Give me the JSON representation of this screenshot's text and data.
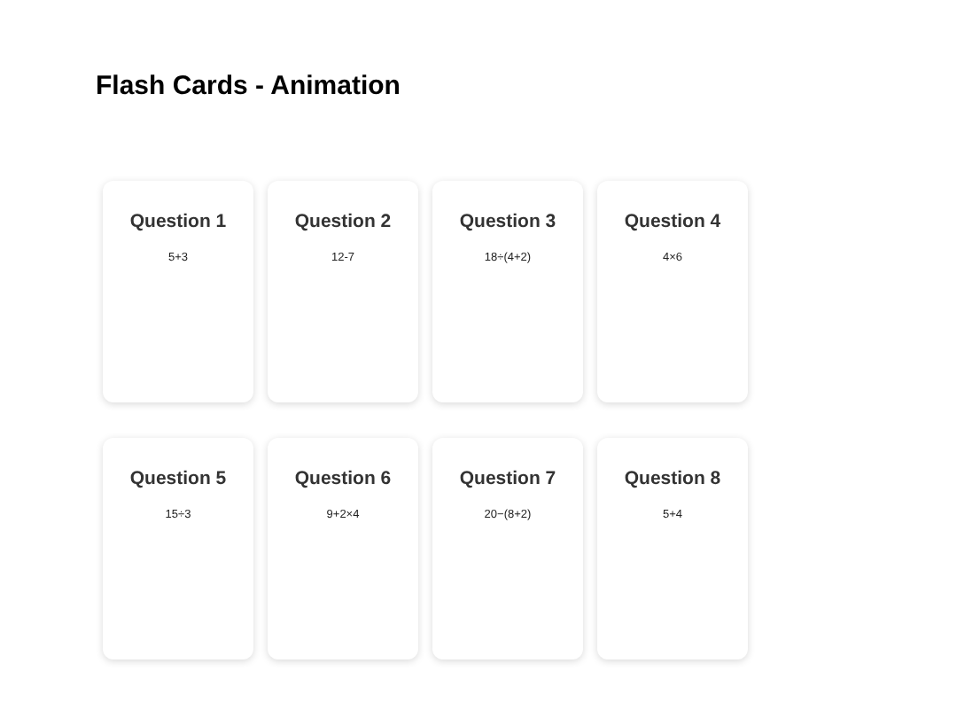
{
  "title": "Flash Cards - Animation",
  "cards": [
    {
      "question": "Question 1",
      "expression": "5+3"
    },
    {
      "question": "Question 2",
      "expression": "12-7"
    },
    {
      "question": "Question 3",
      "expression": "18÷(4+2)"
    },
    {
      "question": "Question 4",
      "expression": "4×6"
    },
    {
      "question": "Question 5",
      "expression": "15÷3"
    },
    {
      "question": "Question 6",
      "expression": "9+2×4"
    },
    {
      "question": "Question 7",
      "expression": "20−(8+2)"
    },
    {
      "question": "Question 8",
      "expression": "5+4"
    }
  ]
}
